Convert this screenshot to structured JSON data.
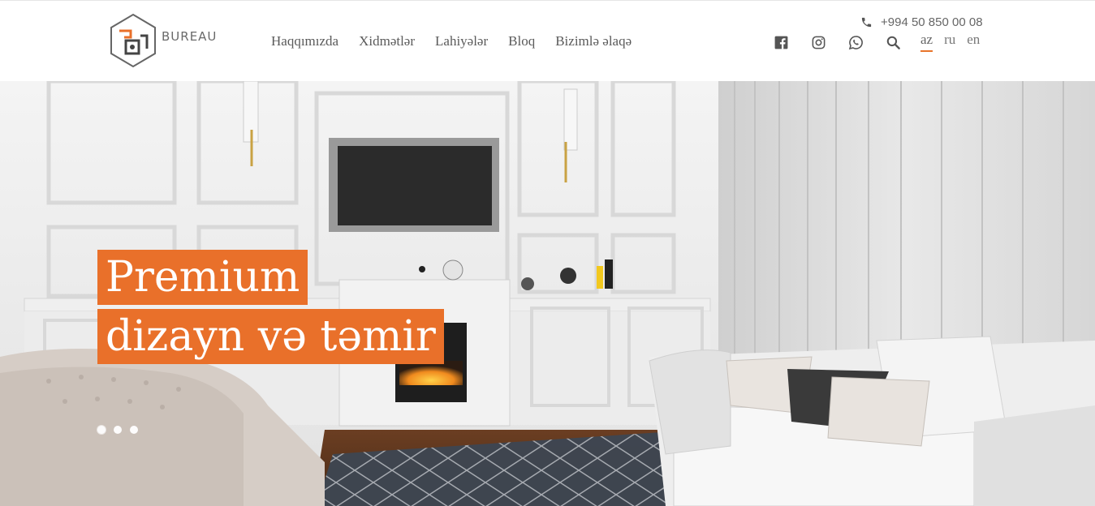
{
  "brand": {
    "name": "BUREAU",
    "colors": {
      "accent": "#e9702a",
      "text": "#5a5a5a"
    }
  },
  "nav": {
    "items": [
      {
        "label": "Haqqımızda"
      },
      {
        "label": "Xidmətlər"
      },
      {
        "label": "Lahiyələr"
      },
      {
        "label": "Bloq"
      },
      {
        "label": "Bizimlə əlaqə"
      }
    ]
  },
  "contact": {
    "phone": "+994 50 850 00 08"
  },
  "social": {
    "icons": [
      "facebook-icon",
      "instagram-icon",
      "whatsapp-icon",
      "search-icon"
    ]
  },
  "languages": {
    "items": [
      "az",
      "ru",
      "en"
    ],
    "active": "az"
  },
  "hero": {
    "headline_line1": "Premium",
    "headline_line2": "dizayn və təmir",
    "slides": 3,
    "active_slide": 1
  }
}
